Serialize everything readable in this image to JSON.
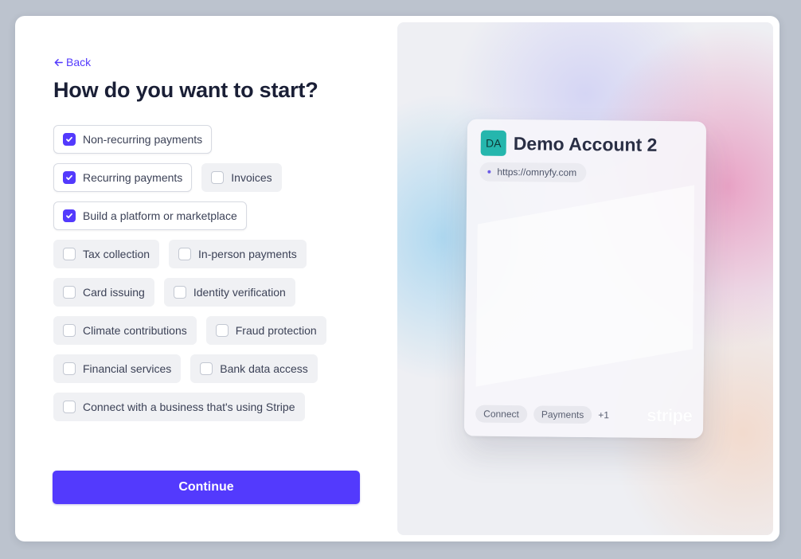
{
  "back_label": "Back",
  "title": "How do you want to start?",
  "options": [
    [
      {
        "label": "Non-recurring payments",
        "checked": true
      }
    ],
    [
      {
        "label": "Recurring payments",
        "checked": true
      },
      {
        "label": "Invoices",
        "checked": false
      }
    ],
    [
      {
        "label": "Build a platform or marketplace",
        "checked": true
      }
    ],
    [
      {
        "label": "Tax collection",
        "checked": false
      },
      {
        "label": "In-person payments",
        "checked": false
      }
    ],
    [
      {
        "label": "Card issuing",
        "checked": false
      },
      {
        "label": "Identity verification",
        "checked": false
      }
    ],
    [
      {
        "label": "Climate contributions",
        "checked": false
      },
      {
        "label": "Fraud protection",
        "checked": false
      }
    ],
    [
      {
        "label": "Financial services",
        "checked": false
      },
      {
        "label": "Bank data access",
        "checked": false
      }
    ],
    [
      {
        "label": "Connect with a business that's using Stripe",
        "checked": false
      }
    ]
  ],
  "continue_label": "Continue",
  "preview": {
    "avatar_initials": "DA",
    "account_name": "Demo Account 2",
    "url": "https://omnyfy.com",
    "tags": [
      "Connect",
      "Payments"
    ],
    "more_count": "+1",
    "brand": "stripe"
  },
  "colors": {
    "accent": "#533afd",
    "avatar": "#25b6ad",
    "heading": "#1a1f36"
  }
}
